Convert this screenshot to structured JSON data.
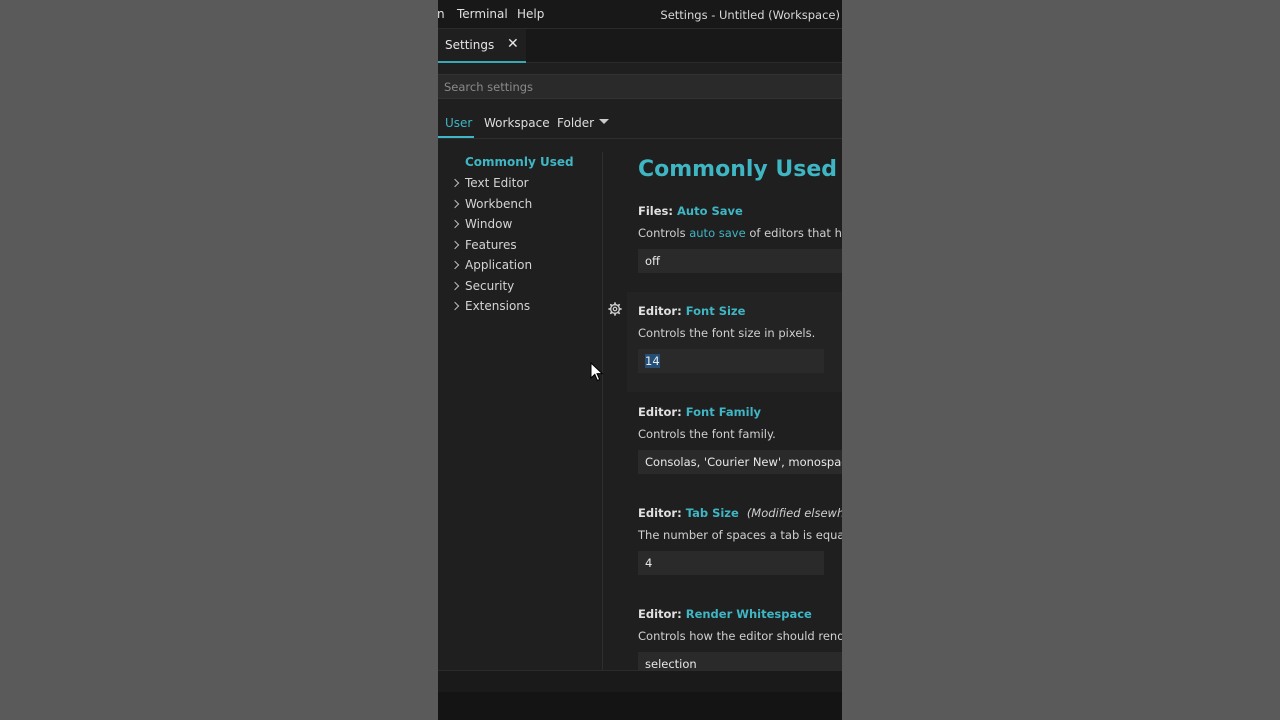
{
  "menu": {
    "partial": "n",
    "terminal": "Terminal",
    "help": "Help"
  },
  "window_title": "Settings - Untitled (Workspace)",
  "editor_tab": {
    "label": "Settings",
    "close_glyph": "✕"
  },
  "search": {
    "placeholder": "Search settings"
  },
  "scope_tabs": {
    "user": "User",
    "workspace": "Workspace",
    "folder": "Folder"
  },
  "toc": {
    "items": [
      "Commonly Used",
      "Text Editor",
      "Workbench",
      "Window",
      "Features",
      "Application",
      "Security",
      "Extensions"
    ]
  },
  "main": {
    "section_title": "Commonly Used",
    "settings": [
      {
        "category": "Files:",
        "key": "Auto Save",
        "desc_pre": "Controls ",
        "desc_link": "auto save",
        "desc_post": " of editors that have",
        "value": "off"
      },
      {
        "category": "Editor:",
        "key": "Font Size",
        "desc": "Controls the font size in pixels.",
        "value": "14"
      },
      {
        "category": "Editor:",
        "key": "Font Family",
        "desc": "Controls the font family.",
        "value": "Consolas, 'Courier New', monospace"
      },
      {
        "category": "Editor:",
        "key": "Tab Size",
        "modified": "(Modified elsewhere)",
        "desc": "The number of spaces a tab is equal to",
        "value": "4"
      },
      {
        "category": "Editor:",
        "key": "Render Whitespace",
        "desc": "Controls how the editor should render",
        "value": "selection"
      }
    ]
  },
  "colors": {
    "accent": "#3fb6c4",
    "background": "#1f1f1f",
    "titlebar": "#181818",
    "input": "#2a2a2a"
  },
  "icons": {
    "gear": "gear-icon",
    "chevron": "chevron-right-icon",
    "cursor": "mouse-pointer-icon"
  }
}
